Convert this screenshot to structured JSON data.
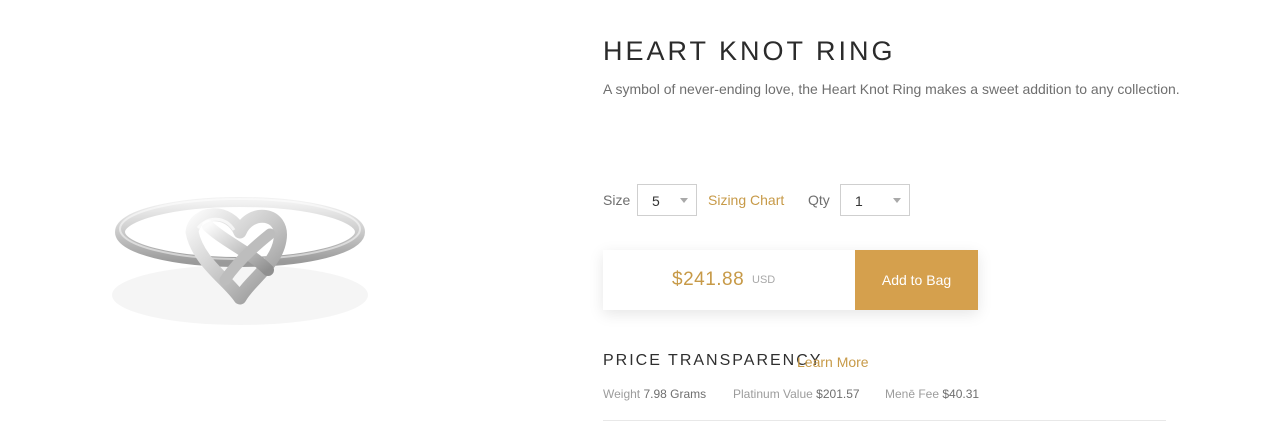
{
  "product": {
    "title": "HEART KNOT RING",
    "description": "A symbol of never-ending love, the Heart Knot Ring makes a sweet addition to any collection.",
    "image_icon": "ring-icon"
  },
  "options": {
    "size_label": "Size",
    "size_value": "5",
    "sizing_chart_link": "Sizing Chart",
    "qty_label": "Qty",
    "qty_value": "1"
  },
  "purchase": {
    "price": "$241.88",
    "currency": "USD",
    "add_to_bag_label": "Add to Bag"
  },
  "transparency": {
    "title": "PRICE TRANSPARENCY",
    "learn_more_link": "Learn More",
    "weight_label": "Weight",
    "weight_value": "7.98 Grams",
    "platinum_label": "Platinum Value",
    "platinum_value": "$201.57",
    "fee_label": "Menē Fee",
    "fee_value": "$40.31"
  },
  "colors": {
    "accent": "#d5a04d",
    "gold_text": "#c79a48"
  }
}
